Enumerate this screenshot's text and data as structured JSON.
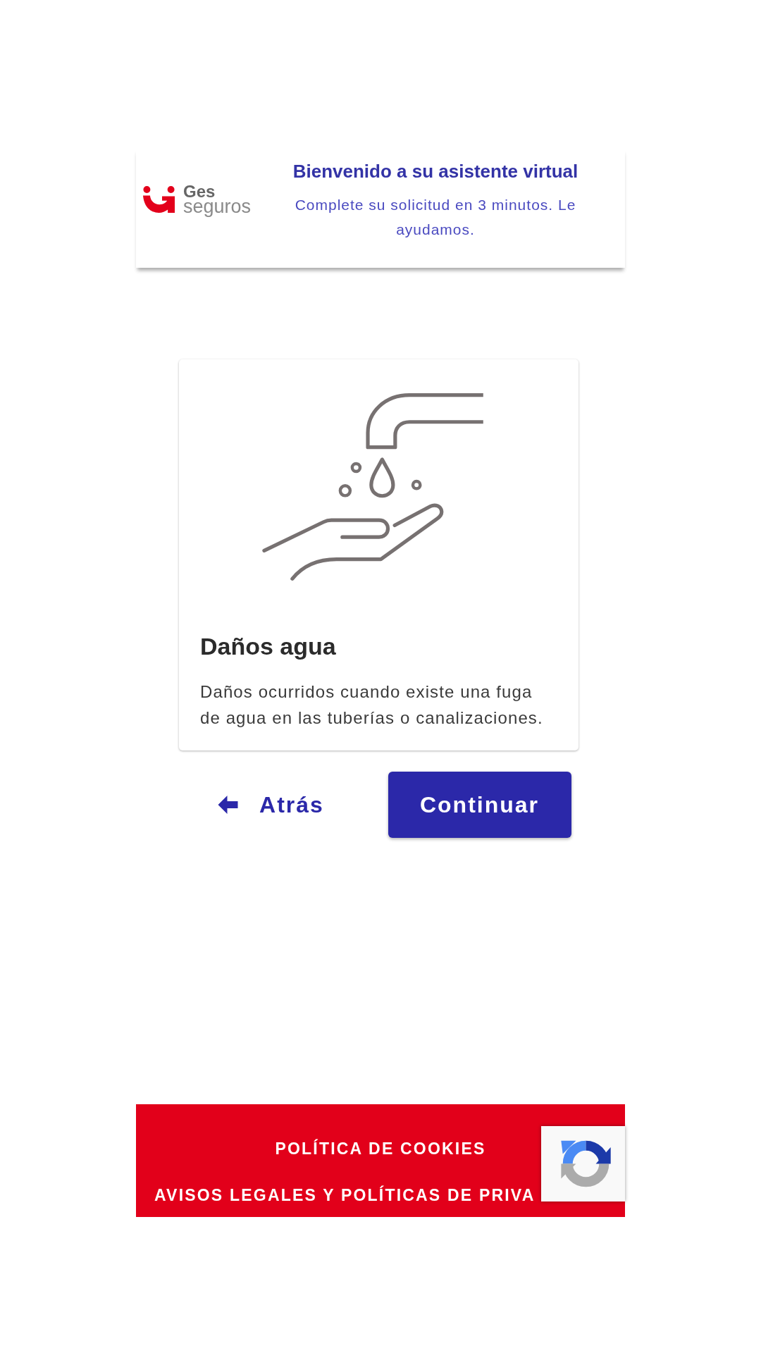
{
  "header": {
    "logo": {
      "top": "Ges",
      "bottom": "seguros"
    },
    "title": "Bienvenido a su asistente virtual",
    "subtitle": "Complete su solicitud en 3 minutos. Le ayudamos."
  },
  "card": {
    "title": "Daños agua",
    "description": "Daños ocurridos cuando existe una fuga de agua en las tuberías o canalizaciones."
  },
  "actions": [
    {
      "kind": "back",
      "label": "Atrás"
    },
    {
      "kind": "primary",
      "label": "Continuar"
    }
  ],
  "footer": {
    "links": [
      "POLÍTICA DE COOKIES",
      "AVISOS LEGALES Y POLÍTICAS DE PRIVA"
    ]
  }
}
